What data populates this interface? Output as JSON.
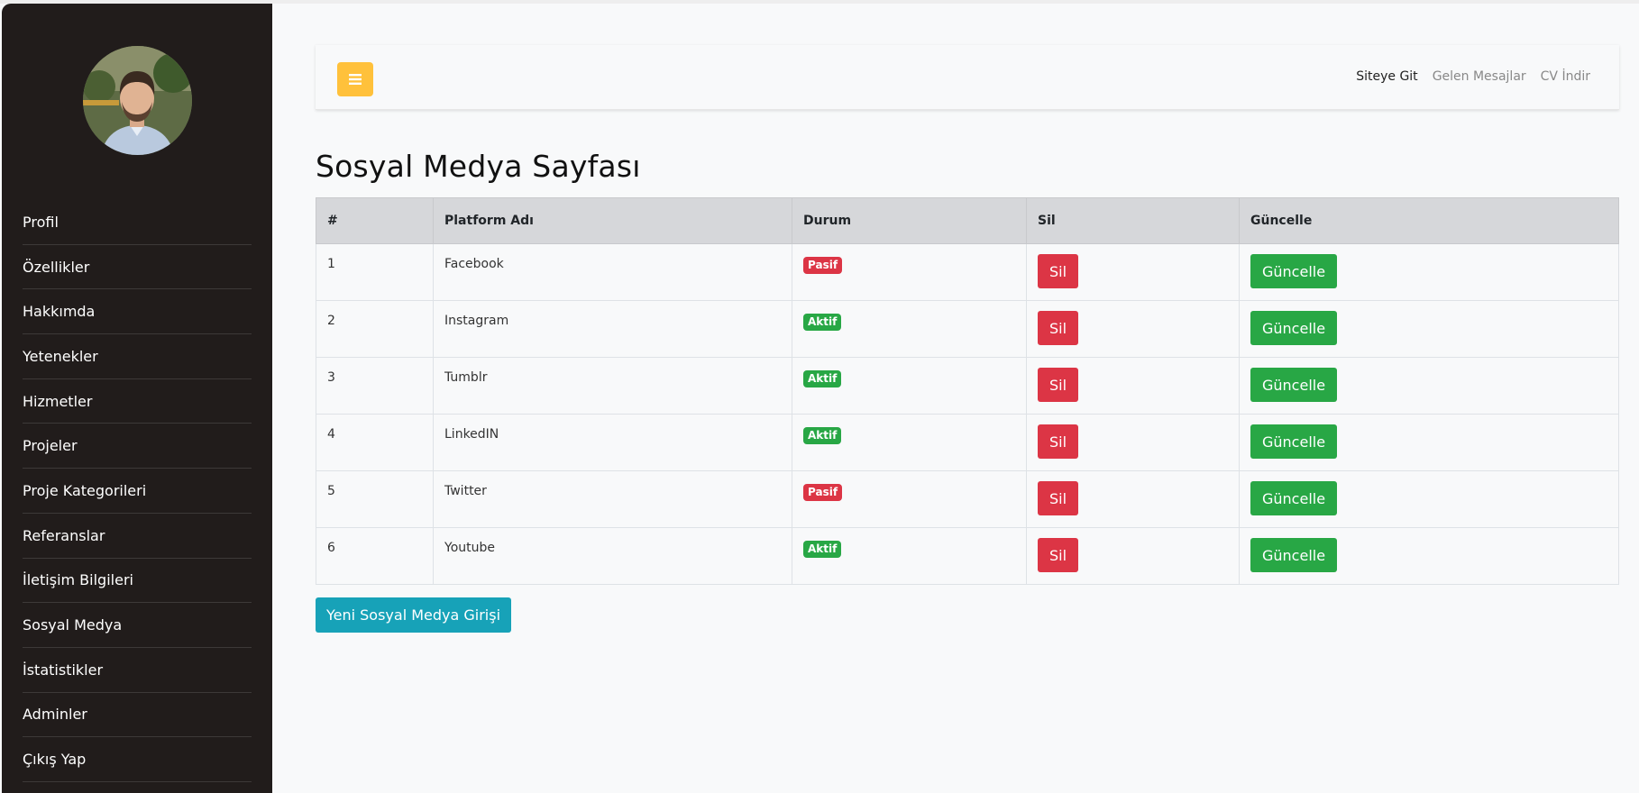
{
  "sidebar": {
    "items": [
      {
        "label": "Profil"
      },
      {
        "label": "Özellikler"
      },
      {
        "label": "Hakkımda"
      },
      {
        "label": "Yetenekler"
      },
      {
        "label": "Hizmetler"
      },
      {
        "label": "Projeler"
      },
      {
        "label": "Proje Kategorileri"
      },
      {
        "label": "Referanslar"
      },
      {
        "label": "İletişim Bilgileri"
      },
      {
        "label": "Sosyal Medya"
      },
      {
        "label": "İstatistikler"
      },
      {
        "label": "Adminler"
      },
      {
        "label": "Çıkış Yap"
      }
    ]
  },
  "topbar": {
    "menu_icon": "bars-icon",
    "links": [
      {
        "label": "Siteye Git"
      },
      {
        "label": "Gelen Mesajlar"
      },
      {
        "label": "CV İndir"
      }
    ]
  },
  "main": {
    "title": "Sosyal Medya Sayfası",
    "table": {
      "headers": [
        "#",
        "Platform Adı",
        "Durum",
        "Sil",
        "Güncelle"
      ],
      "rows": [
        {
          "id": "1",
          "platform": "Facebook",
          "status": "Pasif",
          "delete": "Sil",
          "update": "Güncelle"
        },
        {
          "id": "2",
          "platform": "Instagram",
          "status": "Aktif",
          "delete": "Sil",
          "update": "Güncelle"
        },
        {
          "id": "3",
          "platform": "Tumblr",
          "status": "Aktif",
          "delete": "Sil",
          "update": "Güncelle"
        },
        {
          "id": "4",
          "platform": "LinkedIN",
          "status": "Aktif",
          "delete": "Sil",
          "update": "Güncelle"
        },
        {
          "id": "5",
          "platform": "Twitter",
          "status": "Pasif",
          "delete": "Sil",
          "update": "Güncelle"
        },
        {
          "id": "6",
          "platform": "Youtube",
          "status": "Aktif",
          "delete": "Sil",
          "update": "Güncelle"
        }
      ]
    },
    "new_button": "Yeni Sosyal Medya Girişi"
  },
  "colors": {
    "sidebar_bg": "#211c1b",
    "menu_button": "#ffc13b",
    "danger": "#dc3545",
    "success": "#28a745",
    "info": "#17a2b8"
  }
}
